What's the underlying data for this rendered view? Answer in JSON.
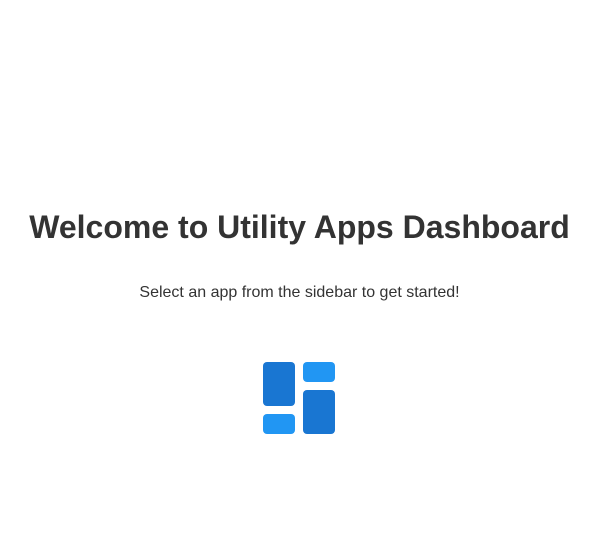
{
  "welcome": {
    "title": "Welcome to Utility Apps Dashboard",
    "subtitle": "Select an app from the sidebar to get started!"
  },
  "icon": {
    "name": "dashboard-icon",
    "colors": {
      "dark": "#1976d2",
      "light": "#2196f3"
    }
  }
}
